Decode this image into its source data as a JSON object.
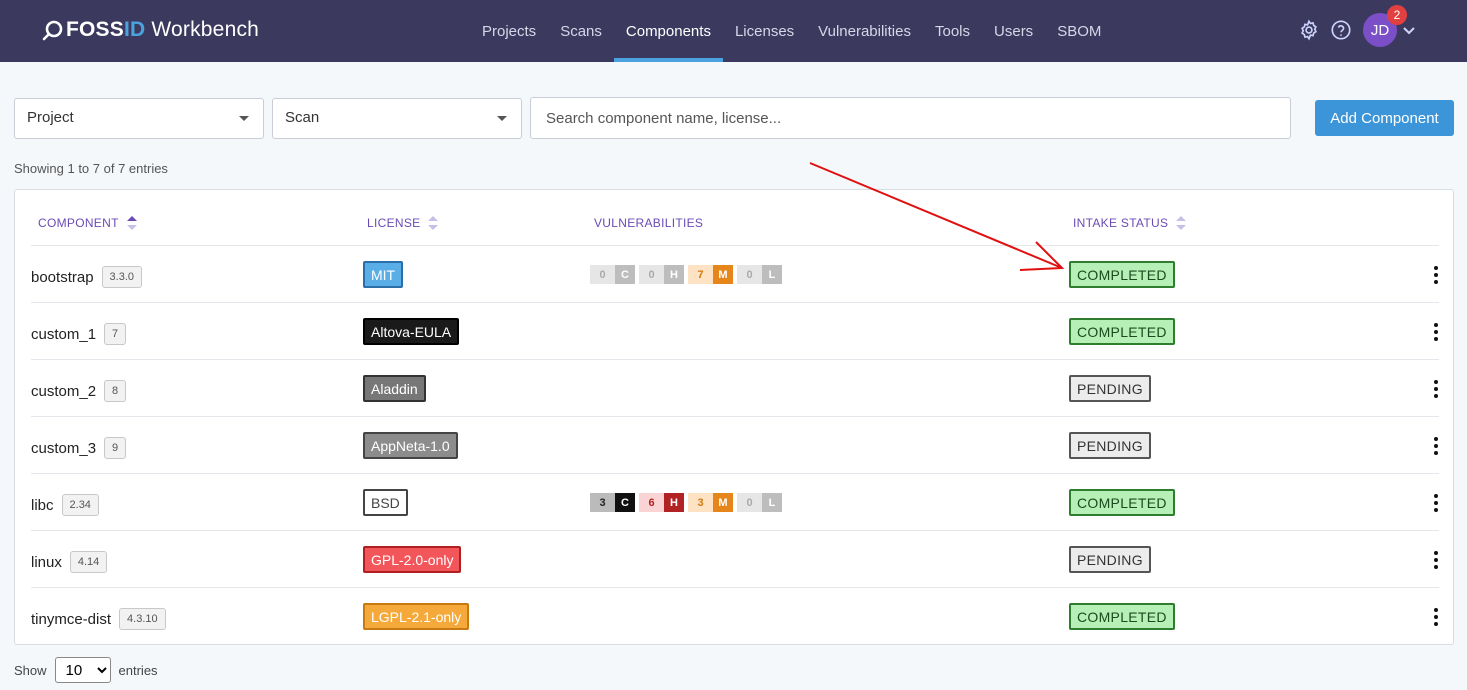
{
  "app": {
    "brand_left": "FOSS",
    "brand_id": "ID",
    "brand_right": "Workbench",
    "nav": [
      "Projects",
      "Scans",
      "Components",
      "Licenses",
      "Vulnerabilities",
      "Tools",
      "Users",
      "SBOM"
    ],
    "active_nav": "Components",
    "user_initials": "JD",
    "notification_count": "2",
    "icons": [
      "gear-icon",
      "help-icon",
      "chevron-down-icon"
    ]
  },
  "filters": {
    "project_label": "Project",
    "scan_label": "Scan",
    "search_placeholder": "Search component name, license...",
    "add_button": "Add Component"
  },
  "summary": "Showing 1 to 7 of 7 entries",
  "table": {
    "columns": [
      "COMPONENT",
      "LICENSE",
      "VULNERABILITIES",
      "INTAKE STATUS"
    ],
    "rows": [
      {
        "name": "bootstrap",
        "version": "3.3.0",
        "license": "MIT",
        "license_style": "blue",
        "vulns": [
          {
            "n": "0",
            "l": "C"
          },
          {
            "n": "0",
            "l": "H"
          },
          {
            "n": "7",
            "l": "M"
          },
          {
            "n": "0",
            "l": "L"
          }
        ],
        "status": "COMPLETED"
      },
      {
        "name": "custom_1",
        "version": "7",
        "license": "Altova-EULA",
        "license_style": "black",
        "vulns": [],
        "status": "COMPLETED"
      },
      {
        "name": "custom_2",
        "version": "8",
        "license": "Aladdin",
        "license_style": "darkgray",
        "vulns": [],
        "status": "PENDING"
      },
      {
        "name": "custom_3",
        "version": "9",
        "license": "AppNeta-1.0",
        "license_style": "gray",
        "vulns": [],
        "status": "PENDING"
      },
      {
        "name": "libc",
        "version": "2.34",
        "license": "BSD",
        "license_style": "white",
        "vulns": [
          {
            "n": "3",
            "l": "C"
          },
          {
            "n": "6",
            "l": "H"
          },
          {
            "n": "3",
            "l": "M"
          },
          {
            "n": "0",
            "l": "L"
          }
        ],
        "status": "COMPLETED"
      },
      {
        "name": "linux",
        "version": "4.14",
        "license": "GPL-2.0-only",
        "license_style": "red",
        "vulns": [],
        "status": "PENDING"
      },
      {
        "name": "tinymce-dist",
        "version": "4.3.10",
        "license": "LGPL-2.1-only",
        "license_style": "orange",
        "vulns": [],
        "status": "COMPLETED"
      }
    ]
  },
  "footer": {
    "show_label": "Show",
    "page_size": "10",
    "entries_label": "entries"
  },
  "colors": {
    "nav_bg": "#3b3a5e",
    "accent": "#3b95d8",
    "header_text": "#6a4bb5",
    "completed_bg": "#b6f0b6",
    "annotation_arrow": "#e01010"
  }
}
